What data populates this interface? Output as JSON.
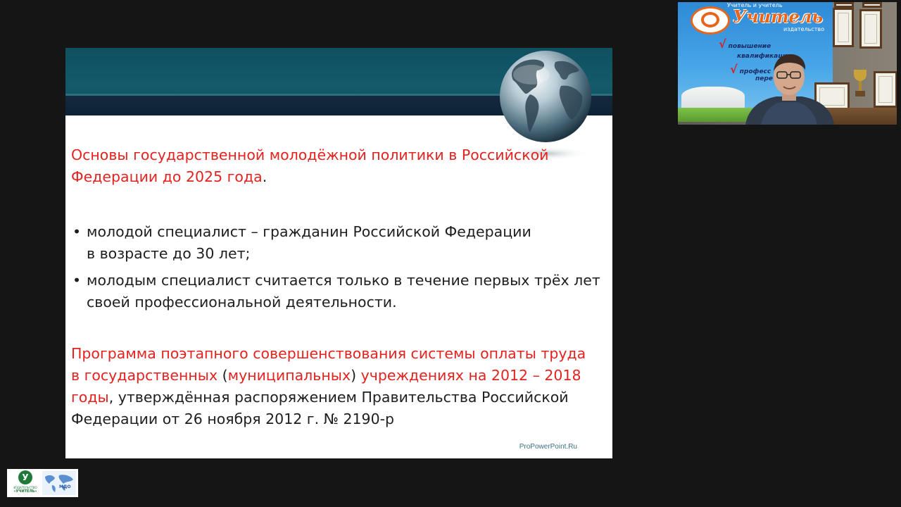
{
  "slide": {
    "title_line1": "Основы государственной молодёжной политики в Российской",
    "title_line2": "Федерации до 2025 года",
    "title_period": ".",
    "bullets": [
      {
        "line1": "молодой специалист – гражданин Российской Федерации",
        "line2": "в возрасте до 30 лет;"
      },
      {
        "line1": "молодым специалист считается только в течение первых трёх лет",
        "line2": "своей профессиональной деятельности."
      }
    ],
    "bullet_glyph": "•",
    "program": {
      "line1": "Программа поэтапного совершенствования системы оплаты труда",
      "line2_a": "в государственных",
      "line2_b": " (",
      "line2_c": "муниципальных",
      "line2_d": ") ",
      "line2_e": "учреждениях на 2012 – 2018",
      "line3_red": "годы",
      "line3_rest": ", утверждённая распоряжением Правительства Российской",
      "line4": "Федерации от 26 ноября 2012 г. № 2190-р"
    },
    "footer_credit": "ProPowerPoint.Ru",
    "colors": {
      "accent_red": "#e3231f",
      "header_teal": "#135a6b",
      "header_navy": "#14293f"
    }
  },
  "webcam": {
    "banner_top": "Учитель и учитель",
    "banner_brand": "Учитель",
    "banner_sub": "издательство",
    "banner_lines": [
      "повышение",
      "квалификации",
      "професс",
      "пере"
    ],
    "check_glyph": "√"
  },
  "logos": {
    "left_circle_letter": "У",
    "left_caption_small": "ИЗДАТЕЛЬСТВО",
    "left_caption_big": "«УЧИТЕЛЬ»",
    "right_label": "МДО"
  }
}
